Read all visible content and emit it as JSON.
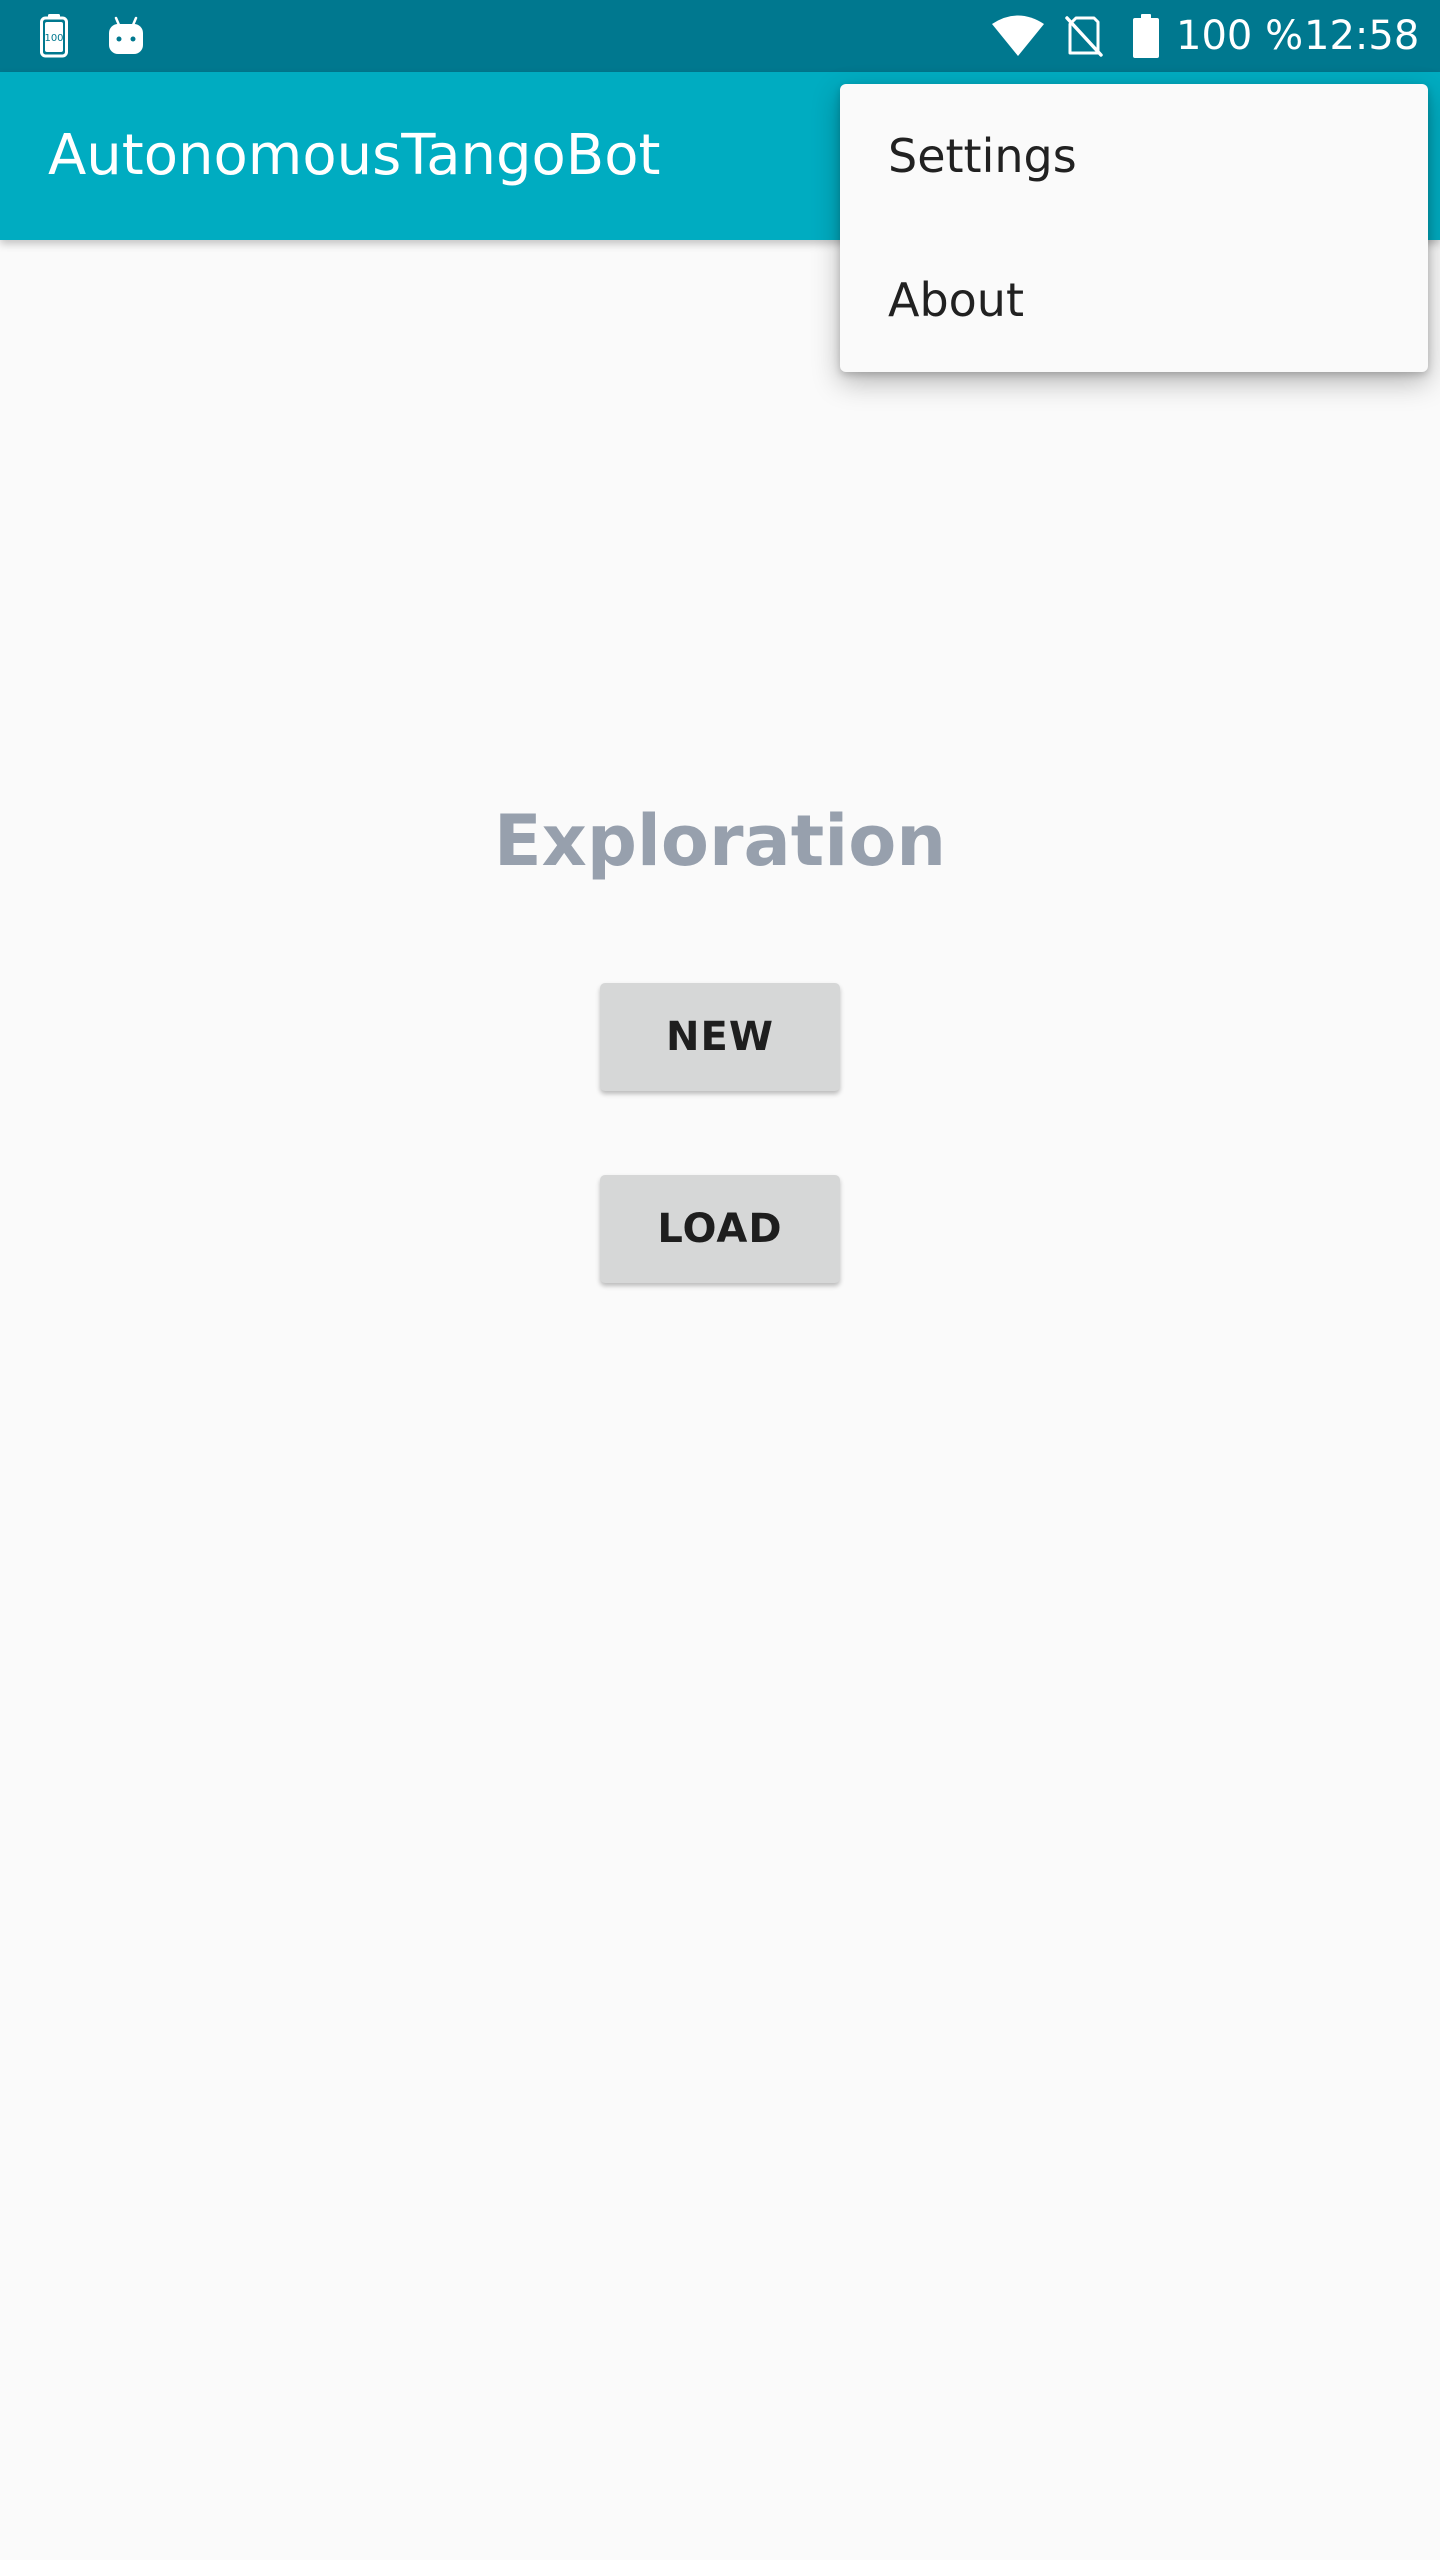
{
  "status_bar": {
    "notification_icons": [
      "battery-100-notification-icon",
      "android-robot-icon"
    ],
    "notification_badge_text": "100",
    "system_icons": [
      "wifi-icon",
      "no-sim-icon",
      "battery-icon"
    ],
    "battery_text": "100 %",
    "time": "12:58"
  },
  "app_bar": {
    "title": "AutonomousTangoBot"
  },
  "main": {
    "headline": "Exploration",
    "new_button_label": "NEW",
    "load_button_label": "LOAD"
  },
  "overflow_menu": {
    "items": [
      {
        "label": "Settings"
      },
      {
        "label": "About"
      }
    ]
  },
  "colors": {
    "status_bar": "#00788f",
    "app_bar": "#00acc1",
    "background": "#fafafa",
    "headline": "#97a0ad",
    "button": "#d6d7d7"
  }
}
